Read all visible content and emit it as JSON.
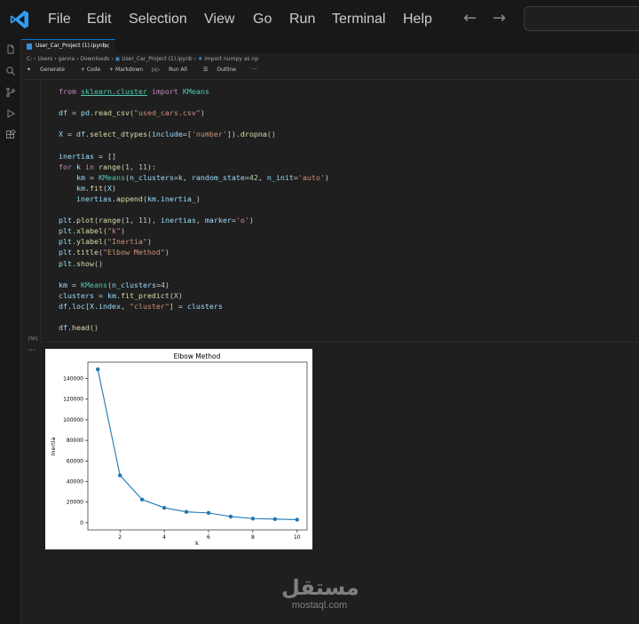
{
  "menu": {
    "items": [
      "File",
      "Edit",
      "Selection",
      "View",
      "Go",
      "Run",
      "Terminal",
      "Help"
    ]
  },
  "tab": {
    "label": "User_Car_Project (1).ipynb",
    "close": "×"
  },
  "breadcrumb": {
    "items": [
      "C:",
      "Users",
      "ganna",
      "Downloads",
      "User_Car_Project (1).ipynb",
      "import numpy as np"
    ]
  },
  "toolbar": {
    "generate": "Generate",
    "code": "+ Code",
    "markdown": "+ Markdown",
    "run_all": "Run All",
    "outline": "Outline",
    "more": "···"
  },
  "cell": {
    "execution_count": "[56]",
    "code_lines": [
      "from sklearn.cluster import KMeans",
      "",
      "df = pd.read_csv(\"used_cars.csv\")",
      "",
      "X = df.select_dtypes(include=['number']).dropna()",
      "",
      "inertias = []",
      "for k in range(1, 11):",
      "    km = KMeans(n_clusters=k, random_state=42, n_init='auto')",
      "    km.fit(X)",
      "    inertias.append(km.inertia_)",
      "",
      "plt.plot(range(1, 11), inertias, marker='o')",
      "plt.xlabel(\"k\")",
      "plt.ylabel(\"Inertia\")",
      "plt.title(\"Elbow Method\")",
      "plt.show()",
      "",
      "km = KMeans(n_clusters=4)",
      "clusters = km.fit_predict(X)",
      "df.loc[X.index, \"cluster\"] = clusters",
      "",
      "df.head()"
    ]
  },
  "output": {
    "dots": "···"
  },
  "chart_data": {
    "type": "line",
    "title": "Elbow Method",
    "xlabel": "k",
    "ylabel": "Inertia",
    "x": [
      1,
      2,
      3,
      4,
      5,
      6,
      7,
      8,
      9,
      10
    ],
    "series": [
      {
        "values": [
          149000,
          46000,
          22500,
          14500,
          10500,
          9500,
          6000,
          4000,
          3500,
          3000
        ]
      }
    ],
    "xticks": [
      2,
      4,
      6,
      8,
      10
    ],
    "yticks": [
      0,
      20000,
      40000,
      60000,
      80000,
      100000,
      120000,
      140000
    ],
    "xlim": [
      0.55,
      10.45
    ],
    "ylim": [
      -7000,
      156000
    ],
    "marker": "o",
    "color": "#1f77b4",
    "grid": false
  },
  "watermark": {
    "arabic": "مستقل",
    "latin": "mostaql.com"
  }
}
